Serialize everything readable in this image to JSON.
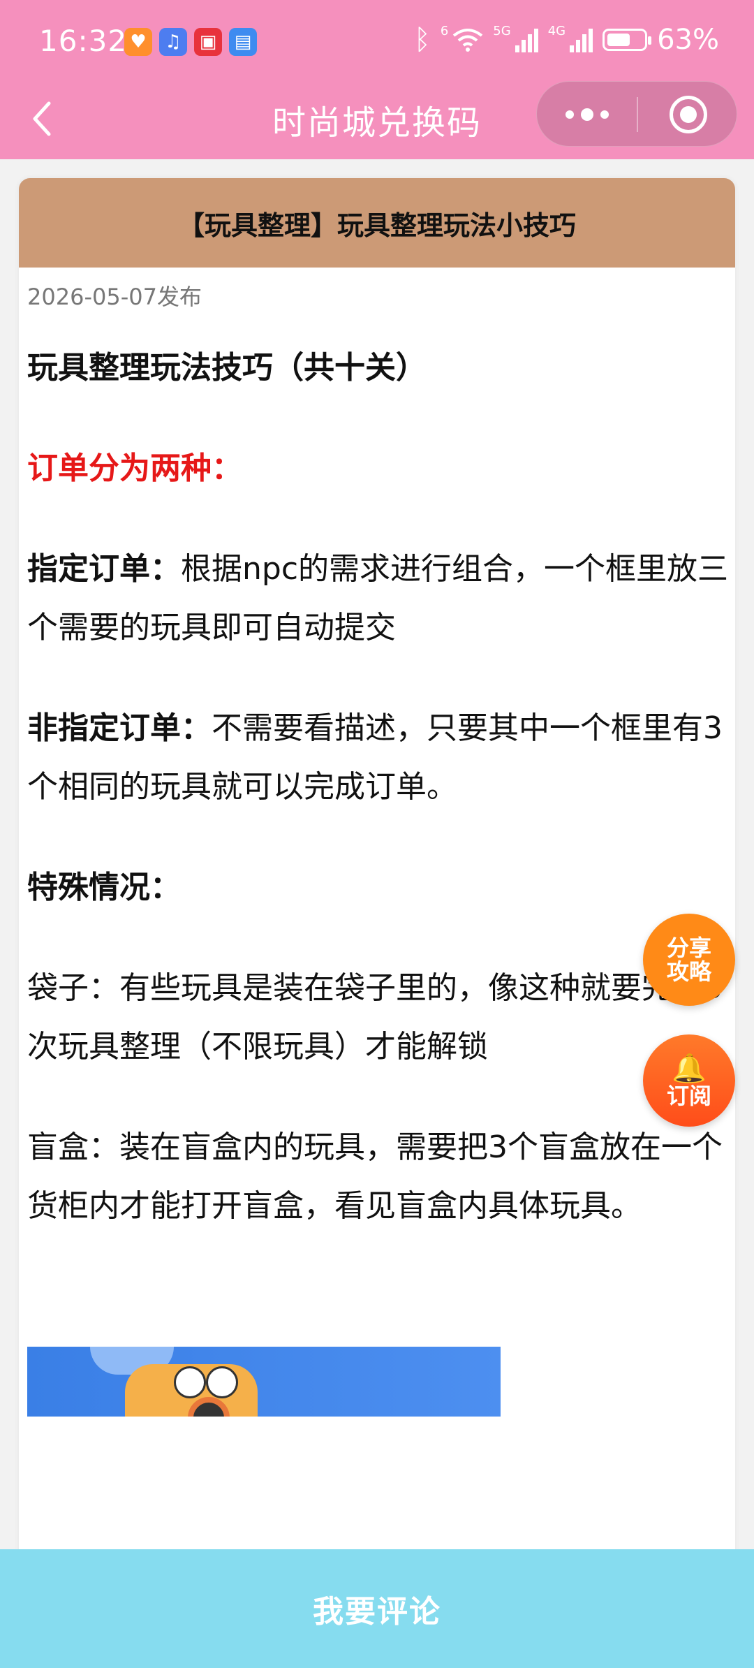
{
  "status_bar": {
    "time": "16:32",
    "wifi_tag": "6",
    "net1": "5G",
    "net2": "4G",
    "battery": "63%"
  },
  "nav": {
    "title": "时尚城兑换码",
    "back_icon": "back-chevron-icon",
    "more_icon": "more-dots-icon",
    "close_icon": "target-close-icon"
  },
  "article": {
    "header_title": "【玩具整理】玩具整理玩法小技巧",
    "date": "2026-05-07发布",
    "heading": "玩具整理玩法技巧（共十关）",
    "orders_title": "订单分为两种：",
    "p1_bold": "指定订单：",
    "p1_text": "根据npc的需求进行组合，一个框里放三个需要的玩具即可自动提交",
    "p2_bold": "非指定订单：",
    "p2_text": "不需要看描述，只要其中一个框里有3个相同的玩具就可以完成订单。",
    "special_title": "特殊情况：",
    "p3_text": "袋子：有些玩具是装在袋子里的，像这种就要完成3次玩具整理（不限玩具）才能解锁",
    "p4_text": "盲盒：装在盲盒内的玩具，需要把3个盲盒放在一个货柜内才能打开盲盒，看见盲盒内具体玩具。"
  },
  "fab": {
    "share_line1": "分享",
    "share_line2": "攻略",
    "subscribe": "订阅",
    "bell_icon": "bell-icon"
  },
  "bottom_bar": {
    "comment_label": "我要评论"
  },
  "colors": {
    "nav_bg": "#f590bd",
    "card_header": "#cc9a76",
    "accent_red": "#e61818",
    "share_orange": "#ff8a17",
    "bottom_bar": "#86dcef"
  }
}
